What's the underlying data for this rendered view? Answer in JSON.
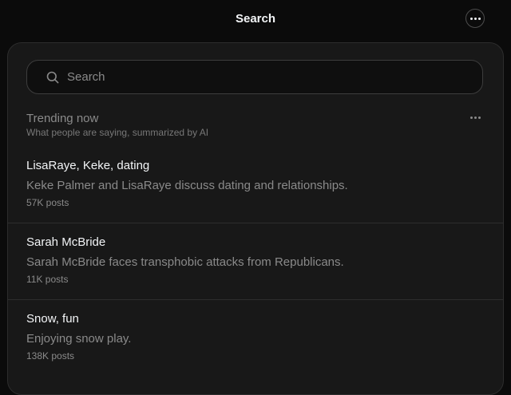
{
  "header": {
    "title": "Search",
    "more_icon": "more-horizontal-icon"
  },
  "search": {
    "placeholder": "Search",
    "value": "",
    "icon": "search-icon"
  },
  "trending": {
    "title": "Trending now",
    "subtitle": "What people are saying, summarized by AI",
    "more_icon": "more-horizontal-icon",
    "items": [
      {
        "title": "LisaRaye, Keke, dating",
        "description": "Keke Palmer and LisaRaye discuss dating and relationships.",
        "count": "57K posts"
      },
      {
        "title": "Sarah McBride",
        "description": "Sarah McBride faces transphobic attacks from Republicans.",
        "count": "11K posts"
      },
      {
        "title": "Snow, fun",
        "description": "Enjoying snow play.",
        "count": "138K posts"
      }
    ]
  },
  "colors": {
    "background": "#0b0b0b",
    "panel": "#181818",
    "text_primary": "#f3f5f7",
    "text_secondary": "#8a8a8a",
    "divider": "#2d2d2d"
  }
}
